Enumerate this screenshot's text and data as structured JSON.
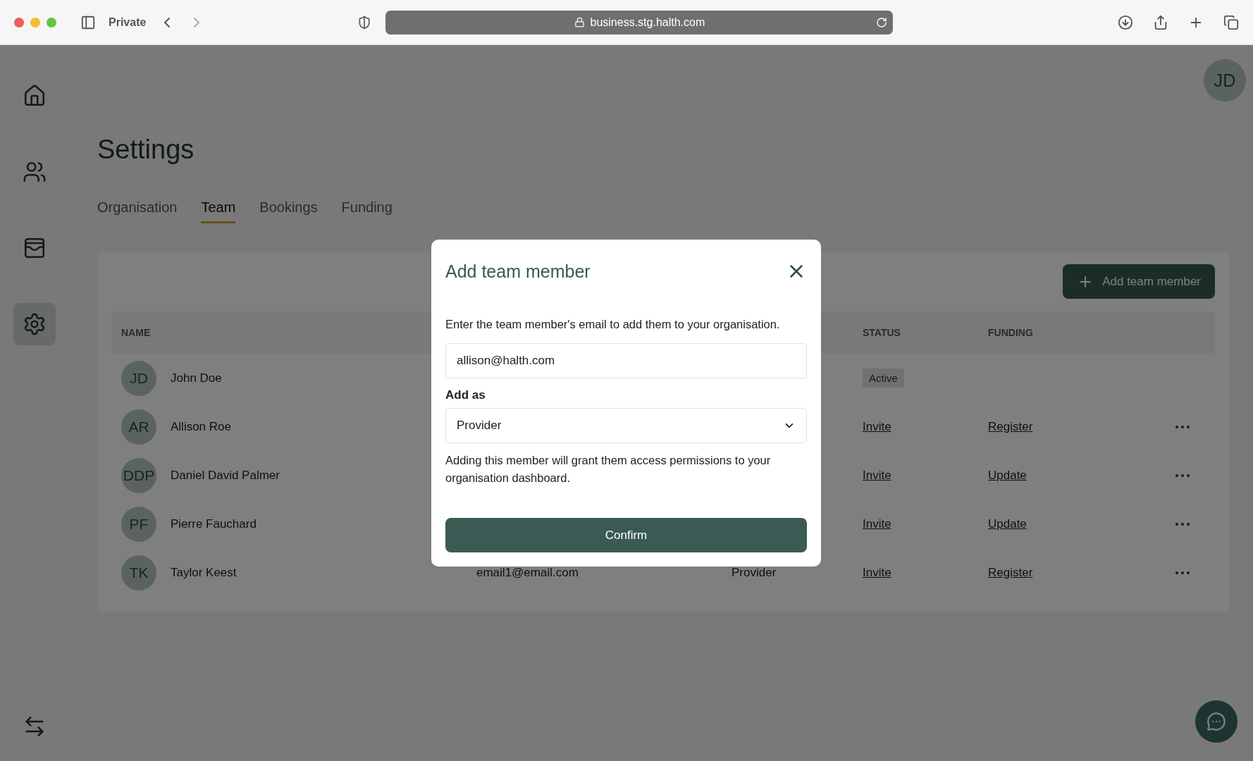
{
  "browser": {
    "window_label": "Private",
    "url": "business.stg.halth.com"
  },
  "sidebar": {
    "items": [
      {
        "kind": "home",
        "selected": false
      },
      {
        "kind": "people",
        "selected": false
      },
      {
        "kind": "cards",
        "selected": false
      },
      {
        "kind": "settings",
        "selected": true
      }
    ]
  },
  "user_avatar": "JD",
  "page": {
    "title": "Settings",
    "tabs": [
      {
        "label": "Organisation",
        "selected": false
      },
      {
        "label": "Team",
        "selected": true
      },
      {
        "label": "Bookings",
        "selected": false
      },
      {
        "label": "Funding",
        "selected": false
      }
    ]
  },
  "team": {
    "add_button": "Add team member",
    "header": {
      "name": "NAME",
      "status": "STATUS",
      "funding": "FUNDING"
    },
    "rows": [
      {
        "initials": "JD",
        "name": "John Doe",
        "status": {
          "kind": "badge",
          "text": "Active"
        },
        "has_menu": false
      },
      {
        "initials": "AR",
        "name": "Allison Roe",
        "status": {
          "kind": "link",
          "text": "Invite"
        },
        "funding": "Register",
        "has_menu": true
      },
      {
        "initials": "DDP",
        "name": "Daniel David Palmer",
        "status": {
          "kind": "link",
          "text": "Invite"
        },
        "funding": "Update",
        "has_menu": true
      },
      {
        "initials": "PF",
        "name": "Pierre Fauchard",
        "status": {
          "kind": "link",
          "text": "Invite"
        },
        "funding": "Update",
        "has_menu": true
      },
      {
        "initials": "TK",
        "name": "Taylor Keest",
        "email": "email1@email.com",
        "role": "Provider",
        "status": {
          "kind": "link",
          "text": "Invite"
        },
        "funding": "Register",
        "has_menu": true
      }
    ]
  },
  "dialog": {
    "title": "Add team member",
    "intro": "Enter the team member's email to add them to your organisation.",
    "email": "allison@halth.com",
    "role_label": "Add as",
    "role": "Provider",
    "note": "Adding this member will grant them access permissions to your organisation dashboard.",
    "confirm": "Confirm"
  }
}
